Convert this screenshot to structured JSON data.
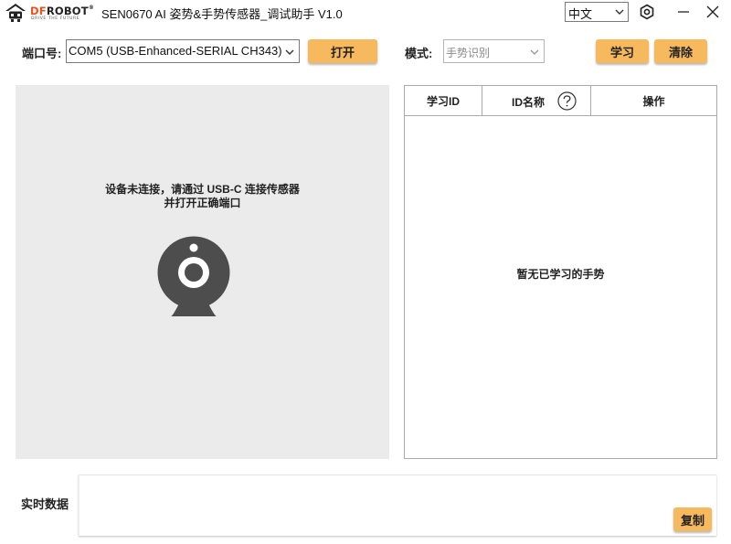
{
  "titlebar": {
    "logo_brand_df": "DF",
    "logo_brand_robot": "ROBOT",
    "logo_reg": "®",
    "logo_tagline": "DRIVE THE FUTURE",
    "title": "SEN0670 AI 姿势&手势传感器_调试助手 V1.0",
    "language": "中文",
    "icons": {
      "settings": "gear-icon",
      "minimize": "minimize-icon",
      "close": "close-icon"
    }
  },
  "toolbar": {
    "port_label": "端口号:",
    "port_value": "COM5 (USB-Enhanced-SERIAL CH343)",
    "open_label": "打开",
    "mode_label": "模式:",
    "mode_value": "手势识别",
    "learn_label": "学习",
    "clear_label": "清除"
  },
  "camera_panel": {
    "status_line1": "设备未连接，请通过 USB-C 连接传感器",
    "status_line2": "并打开正确端口",
    "icon": "webcam-icon"
  },
  "gesture_table": {
    "columns": [
      "学习ID",
      "ID名称",
      "操作"
    ],
    "help_icon": "help-icon",
    "empty_message": "暂无已学习的手势"
  },
  "realtime": {
    "label": "实时数据",
    "content": "",
    "copy_label": "复制"
  },
  "colors": {
    "accent_button": "#f7b95e",
    "brand_orange": "#e8531d",
    "panel_bg": "#ebebeb",
    "icon_gray": "#4d4d4d"
  }
}
